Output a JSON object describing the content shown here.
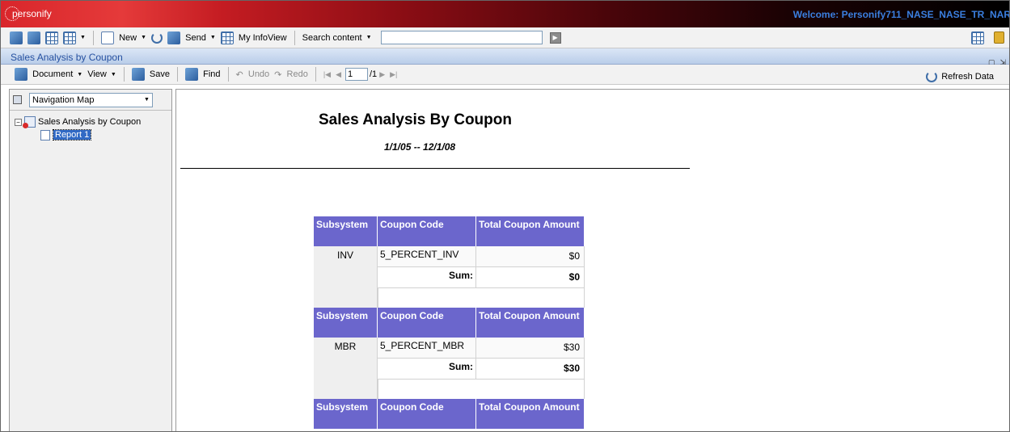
{
  "banner": {
    "logo_text": "personify",
    "welcome": "Welcome: Personify711_NASE_NASE_TR_NAR"
  },
  "toolbar": {
    "new_label": "New",
    "send_label": "Send",
    "infoview_label": "My InfoView",
    "search_label": "Search content",
    "search_value": ""
  },
  "document": {
    "title": "Sales Analysis by Coupon",
    "menu_document": "Document",
    "menu_view": "View",
    "save_label": "Save",
    "find_label": "Find",
    "undo_label": "Undo",
    "redo_label": "Redo",
    "page_current": "1",
    "page_total": "/1",
    "refresh_label": "Refresh Data"
  },
  "navigation": {
    "selector_value": "Navigation Map",
    "tree": {
      "root_label": "Sales Analysis by Coupon",
      "child_label": "Report 1"
    }
  },
  "report": {
    "title": "Sales Analysis By Coupon",
    "date_range": "1/1/05  --  12/1/08",
    "headers": {
      "subsystem": "Subsystem",
      "coupon_code": "Coupon Code",
      "total_amount": "Total Coupon Amount"
    },
    "sum_label": "Sum:",
    "sections": [
      {
        "subsystem": "INV",
        "coupon_code": "5_PERCENT_INV",
        "amount": "$0",
        "sum": "$0"
      },
      {
        "subsystem": "MBR",
        "coupon_code": "5_PERCENT_MBR",
        "amount": "$30",
        "sum": "$30"
      }
    ]
  },
  "colors": {
    "header_bg": "#6b66cc",
    "title_bar_text": "#2550a0",
    "welcome_text": "#3b7fe0"
  }
}
